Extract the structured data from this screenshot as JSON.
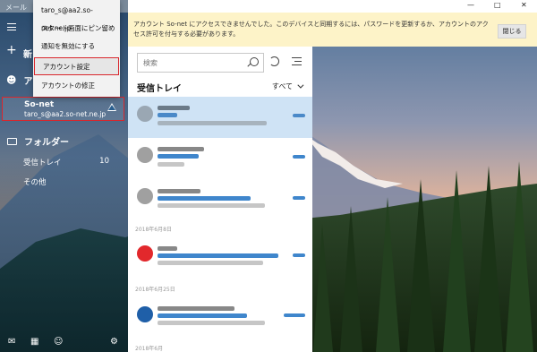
{
  "app": {
    "title": "メール"
  },
  "context_menu": {
    "items": [
      {
        "label": "taro_s@aa2.so-net.ne.jp"
      },
      {
        "label": "スタート画面にピン留め"
      },
      {
        "label": "通知を無効にする"
      },
      {
        "label": "アカウント設定"
      },
      {
        "label": "アカウントの修正"
      }
    ]
  },
  "sidebar": {
    "new_mail": "新",
    "accounts_label": "アカ",
    "account": {
      "name": "So-net",
      "email": "taro_s@aa2.so-net.ne.jp"
    },
    "folders_label": "フォルダー",
    "folders": [
      {
        "label": "受信トレイ",
        "count": "10"
      },
      {
        "label": "その他"
      }
    ]
  },
  "list": {
    "search_placeholder": "検索",
    "inbox_title": "受信トレイ",
    "filter_label": "すべて",
    "groups": [
      {
        "label": "2018年6月8日"
      },
      {
        "label": "2018年6月25日"
      },
      {
        "label": "2018年6月"
      }
    ]
  },
  "banner": {
    "message": "アカウント So-net にアクセスできませんでした。このデバイスと同期するには、パスワードを更新するか、アカウントのアクセス許可を付与する必要があります。",
    "close_label": "閉じる"
  },
  "colors": {
    "accent": "#0063b1",
    "warning_border": "#d9262c",
    "banner_bg": "#fdf3c8"
  }
}
